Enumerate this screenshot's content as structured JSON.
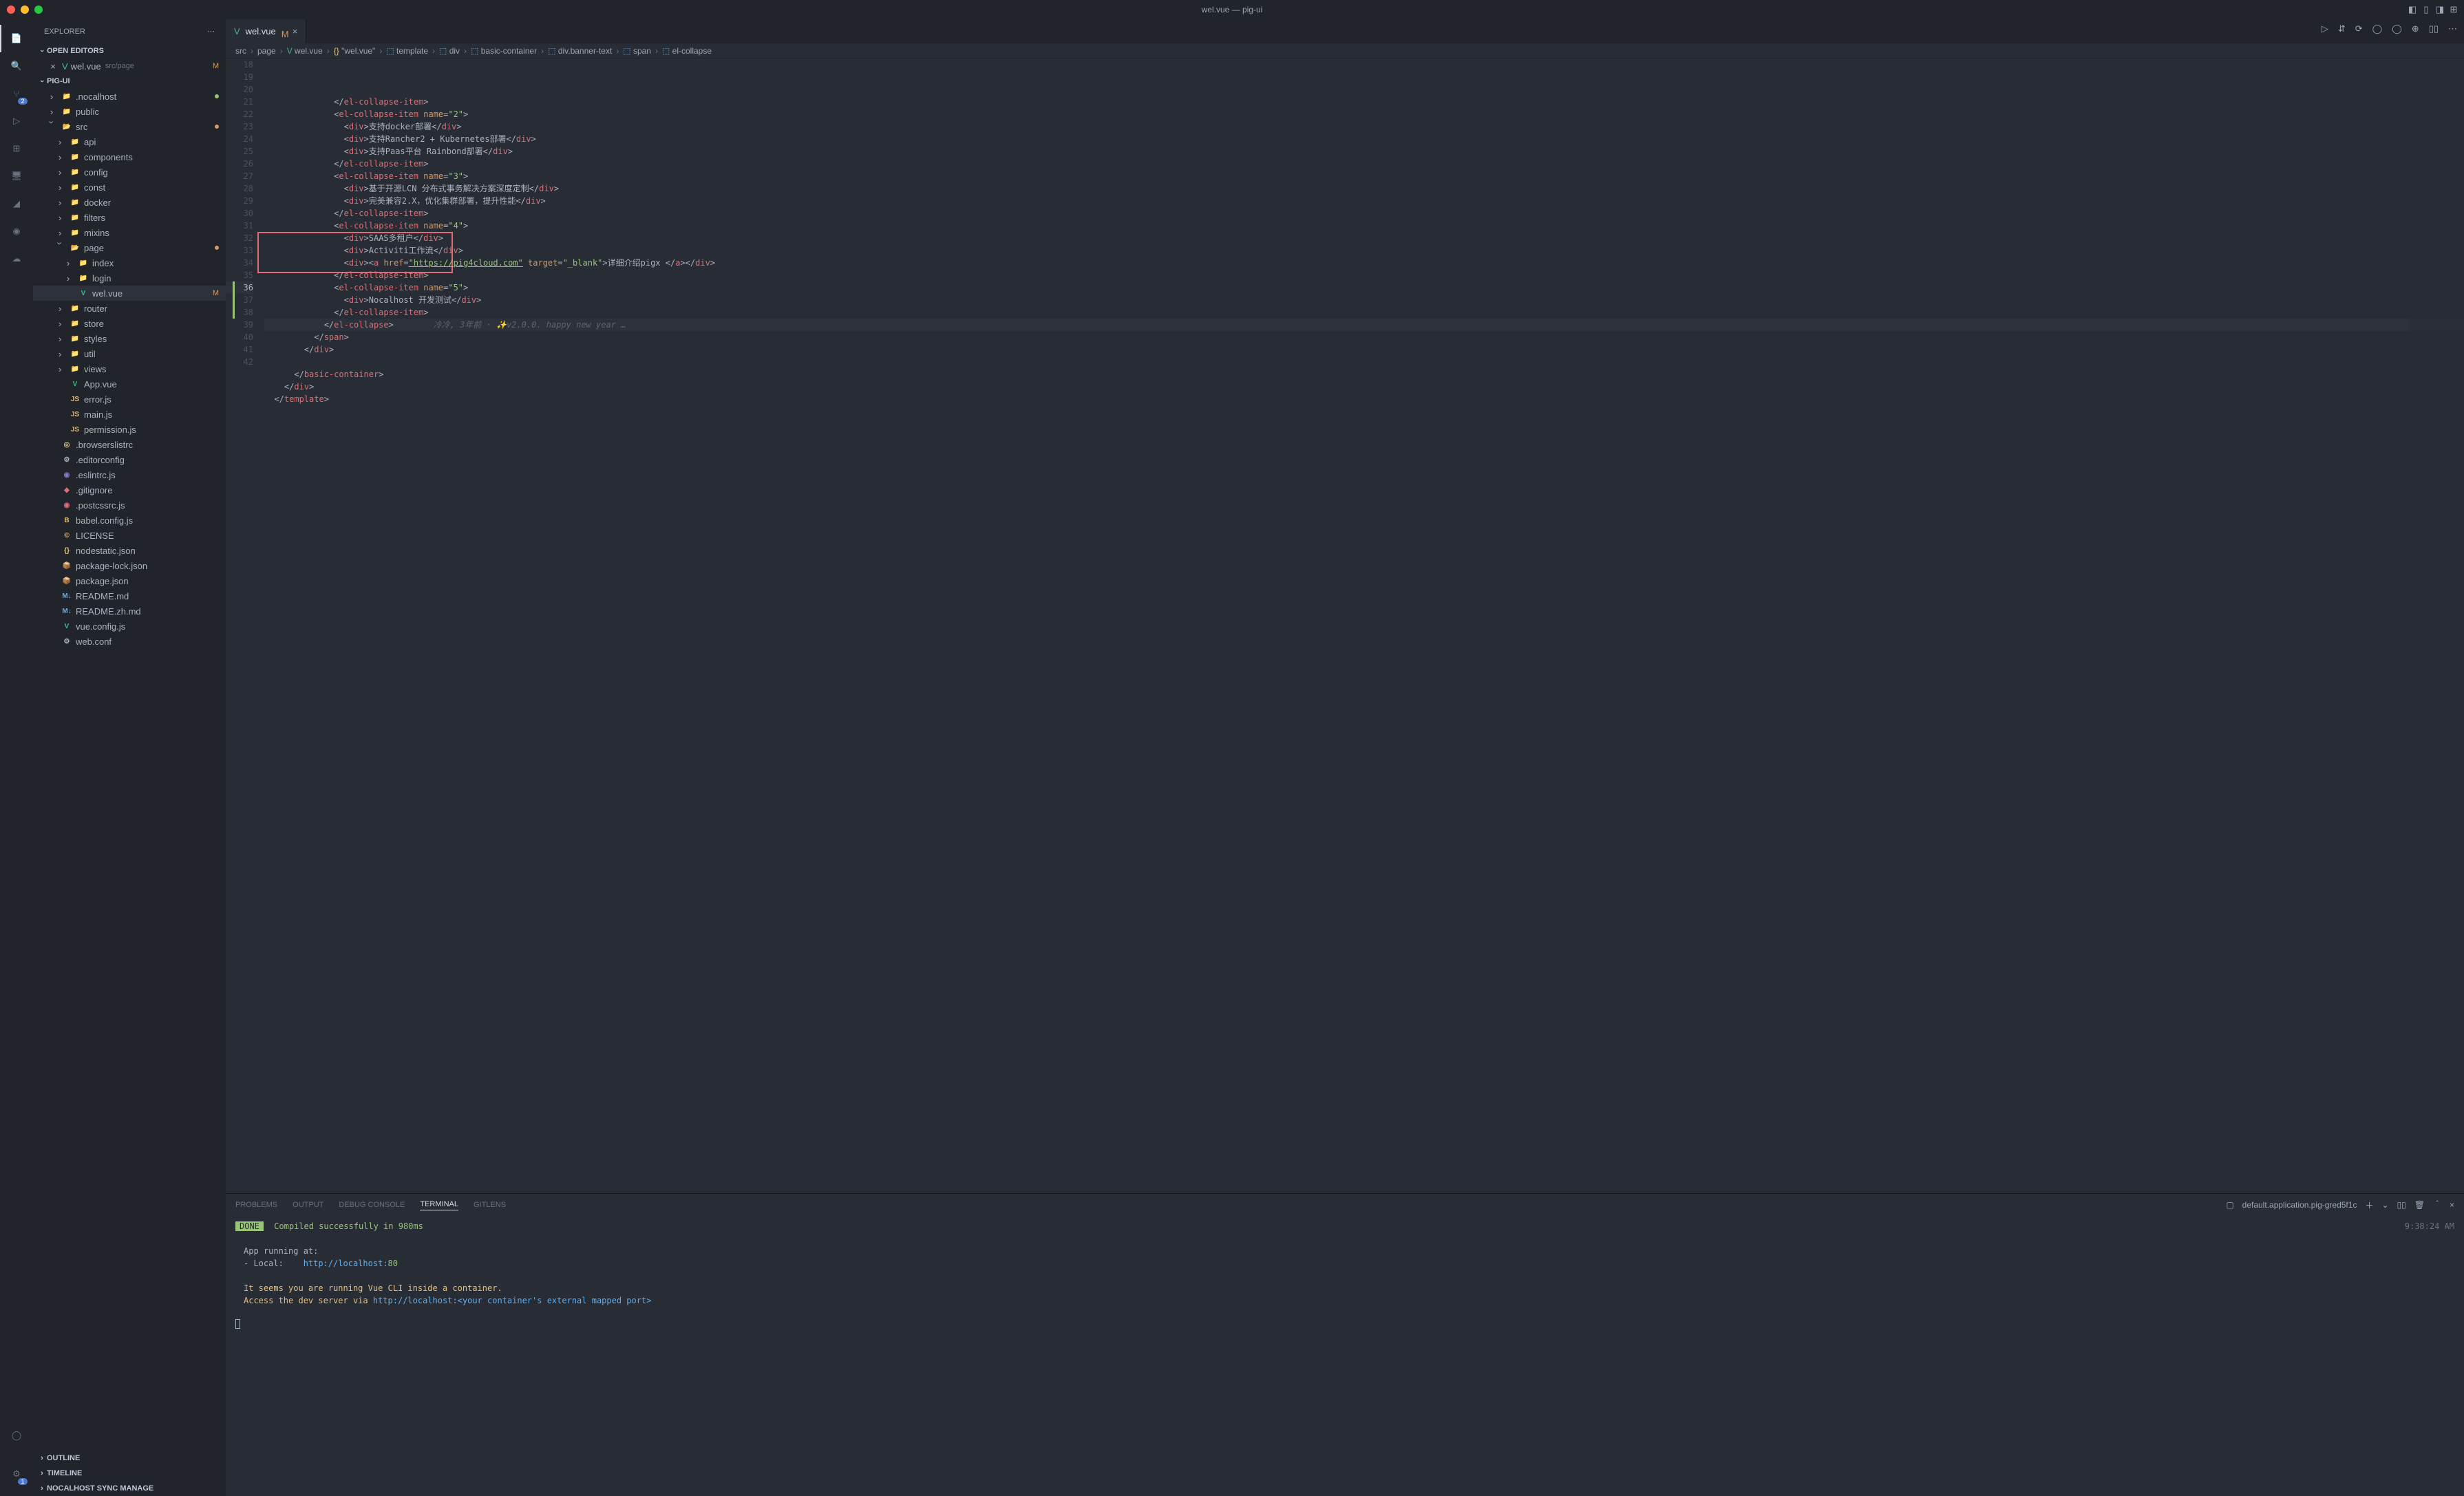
{
  "window": {
    "title": "wel.vue — pig-ui"
  },
  "activitybar": {
    "items": [
      {
        "name": "explorer-icon",
        "active": true
      },
      {
        "name": "search-icon"
      },
      {
        "name": "source-control-icon",
        "badge": "2"
      },
      {
        "name": "run-debug-icon"
      },
      {
        "name": "extensions-icon"
      },
      {
        "name": "remote-explorer-icon"
      },
      {
        "name": "docker-icon"
      },
      {
        "name": "nocalhost-icon"
      },
      {
        "name": "cloud-icon"
      }
    ],
    "bottom": [
      {
        "name": "accounts-icon"
      },
      {
        "name": "settings-gear-icon",
        "badge": "1"
      }
    ]
  },
  "sidebar": {
    "title": "EXPLORER",
    "sections": {
      "openEditors": {
        "label": "OPEN EDITORS",
        "items": [
          {
            "icon": "vue",
            "label": "wel.vue",
            "path": "src/page",
            "status": "M"
          }
        ]
      },
      "project": {
        "label": "PIG-UI",
        "tree": [
          {
            "depth": 1,
            "chev": ">",
            "icon": "folder",
            "label": ".nocalhost",
            "dot": "#98c379"
          },
          {
            "depth": 1,
            "chev": ">",
            "icon": "folder",
            "label": "public"
          },
          {
            "depth": 1,
            "chev": "v",
            "icon": "folder-open",
            "label": "src",
            "dot": "#d19a66"
          },
          {
            "depth": 2,
            "chev": ">",
            "icon": "folder",
            "label": "api"
          },
          {
            "depth": 2,
            "chev": ">",
            "icon": "folder",
            "label": "components"
          },
          {
            "depth": 2,
            "chev": ">",
            "icon": "folder",
            "label": "config"
          },
          {
            "depth": 2,
            "chev": ">",
            "icon": "folder",
            "label": "const"
          },
          {
            "depth": 2,
            "chev": ">",
            "icon": "folder",
            "label": "docker"
          },
          {
            "depth": 2,
            "chev": ">",
            "icon": "folder",
            "label": "filters"
          },
          {
            "depth": 2,
            "chev": ">",
            "icon": "folder",
            "label": "mixins"
          },
          {
            "depth": 2,
            "chev": "v",
            "icon": "folder-open",
            "label": "page",
            "dot": "#d19a66"
          },
          {
            "depth": 3,
            "chev": ">",
            "icon": "folder",
            "label": "index"
          },
          {
            "depth": 3,
            "chev": ">",
            "icon": "folder",
            "label": "login"
          },
          {
            "depth": 3,
            "chev": "",
            "icon": "vue",
            "label": "wel.vue",
            "status": "M",
            "selected": true
          },
          {
            "depth": 2,
            "chev": ">",
            "icon": "folder",
            "label": "router"
          },
          {
            "depth": 2,
            "chev": ">",
            "icon": "folder",
            "label": "store"
          },
          {
            "depth": 2,
            "chev": ">",
            "icon": "folder",
            "label": "styles"
          },
          {
            "depth": 2,
            "chev": ">",
            "icon": "folder",
            "label": "util"
          },
          {
            "depth": 2,
            "chev": ">",
            "icon": "folder",
            "label": "views"
          },
          {
            "depth": 2,
            "chev": "",
            "icon": "vue",
            "label": "App.vue"
          },
          {
            "depth": 2,
            "chev": "",
            "icon": "js",
            "label": "error.js"
          },
          {
            "depth": 2,
            "chev": "",
            "icon": "js",
            "label": "main.js"
          },
          {
            "depth": 2,
            "chev": "",
            "icon": "js",
            "label": "permission.js"
          },
          {
            "depth": 1,
            "chev": "",
            "icon": "browserslist",
            "label": ".browserslistrc"
          },
          {
            "depth": 1,
            "chev": "",
            "icon": "editorconfig",
            "label": ".editorconfig"
          },
          {
            "depth": 1,
            "chev": "",
            "icon": "eslint",
            "label": ".eslintrc.js"
          },
          {
            "depth": 1,
            "chev": "",
            "icon": "git",
            "label": ".gitignore"
          },
          {
            "depth": 1,
            "chev": "",
            "icon": "postcss",
            "label": ".postcssrc.js"
          },
          {
            "depth": 1,
            "chev": "",
            "icon": "babel",
            "label": "babel.config.js"
          },
          {
            "depth": 1,
            "chev": "",
            "icon": "license",
            "label": "LICENSE"
          },
          {
            "depth": 1,
            "chev": "",
            "icon": "json",
            "label": "nodestatic.json"
          },
          {
            "depth": 1,
            "chev": "",
            "icon": "npm",
            "label": "package-lock.json"
          },
          {
            "depth": 1,
            "chev": "",
            "icon": "npm",
            "label": "package.json"
          },
          {
            "depth": 1,
            "chev": "",
            "icon": "md",
            "label": "README.md"
          },
          {
            "depth": 1,
            "chev": "",
            "icon": "md",
            "label": "README.zh.md"
          },
          {
            "depth": 1,
            "chev": "",
            "icon": "vue",
            "label": "vue.config.js"
          },
          {
            "depth": 1,
            "chev": "",
            "icon": "config",
            "label": "web.conf"
          }
        ]
      },
      "outline": {
        "label": "OUTLINE"
      },
      "timeline": {
        "label": "TIMELINE"
      },
      "nocalhost": {
        "label": "NOCALHOST SYNC MANAGE"
      }
    }
  },
  "tab": {
    "icon": "vue",
    "label": "wel.vue",
    "modified": "M"
  },
  "breadcrumbs": [
    {
      "label": "src"
    },
    {
      "label": "page"
    },
    {
      "label": "wel.vue",
      "icon": "vue"
    },
    {
      "label": "\"wel.vue\"",
      "icon": "braces"
    },
    {
      "label": "template",
      "icon": "tag"
    },
    {
      "label": "div",
      "icon": "tag"
    },
    {
      "label": "basic-container",
      "icon": "tag"
    },
    {
      "label": "div.banner-text",
      "icon": "tag"
    },
    {
      "label": "span",
      "icon": "tag"
    },
    {
      "label": "el-collapse",
      "icon": "tag"
    }
  ],
  "editor": {
    "startLine": 18,
    "currentLine": 36,
    "lines": [
      {
        "n": 18,
        "indent": 7,
        "tokens": [
          [
            "t-punc",
            "</"
          ],
          [
            "t-tag",
            "el-collapse-item"
          ],
          [
            "t-punc",
            ">"
          ]
        ]
      },
      {
        "n": 19,
        "indent": 7,
        "tokens": [
          [
            "t-punc",
            "<"
          ],
          [
            "t-tag",
            "el-collapse-item"
          ],
          [
            "t-punc",
            " "
          ],
          [
            "t-attr",
            "name"
          ],
          [
            "t-punc",
            "="
          ],
          [
            "t-str",
            "\"2\""
          ],
          [
            "t-punc",
            ">"
          ]
        ]
      },
      {
        "n": 20,
        "indent": 8,
        "tokens": [
          [
            "t-punc",
            "<"
          ],
          [
            "t-tag",
            "div"
          ],
          [
            "t-punc",
            ">"
          ],
          [
            "t-text",
            "支持docker部署"
          ],
          [
            "t-punc",
            "</"
          ],
          [
            "t-tag",
            "div"
          ],
          [
            "t-punc",
            ">"
          ]
        ]
      },
      {
        "n": 21,
        "indent": 8,
        "tokens": [
          [
            "t-punc",
            "<"
          ],
          [
            "t-tag",
            "div"
          ],
          [
            "t-punc",
            ">"
          ],
          [
            "t-text",
            "支持Rancher2 + Kubernetes部署"
          ],
          [
            "t-punc",
            "</"
          ],
          [
            "t-tag",
            "div"
          ],
          [
            "t-punc",
            ">"
          ]
        ]
      },
      {
        "n": 22,
        "indent": 8,
        "tokens": [
          [
            "t-punc",
            "<"
          ],
          [
            "t-tag",
            "div"
          ],
          [
            "t-punc",
            ">"
          ],
          [
            "t-text",
            "支持Paas平台 Rainbond部署"
          ],
          [
            "t-punc",
            "</"
          ],
          [
            "t-tag",
            "div"
          ],
          [
            "t-punc",
            ">"
          ]
        ]
      },
      {
        "n": 23,
        "indent": 7,
        "tokens": [
          [
            "t-punc",
            "</"
          ],
          [
            "t-tag",
            "el-collapse-item"
          ],
          [
            "t-punc",
            ">"
          ]
        ]
      },
      {
        "n": 24,
        "indent": 7,
        "tokens": [
          [
            "t-punc",
            "<"
          ],
          [
            "t-tag",
            "el-collapse-item"
          ],
          [
            "t-punc",
            " "
          ],
          [
            "t-attr",
            "name"
          ],
          [
            "t-punc",
            "="
          ],
          [
            "t-str",
            "\"3\""
          ],
          [
            "t-punc",
            ">"
          ]
        ]
      },
      {
        "n": 25,
        "indent": 8,
        "tokens": [
          [
            "t-punc",
            "<"
          ],
          [
            "t-tag",
            "div"
          ],
          [
            "t-punc",
            ">"
          ],
          [
            "t-text",
            "基于开源LCN 分布式事务解决方案深度定制"
          ],
          [
            "t-punc",
            "</"
          ],
          [
            "t-tag",
            "div"
          ],
          [
            "t-punc",
            ">"
          ]
        ]
      },
      {
        "n": 26,
        "indent": 8,
        "tokens": [
          [
            "t-punc",
            "<"
          ],
          [
            "t-tag",
            "div"
          ],
          [
            "t-punc",
            ">"
          ],
          [
            "t-text",
            "完美兼容2.X，优化集群部署，提升性能"
          ],
          [
            "t-punc",
            "</"
          ],
          [
            "t-tag",
            "div"
          ],
          [
            "t-punc",
            ">"
          ]
        ]
      },
      {
        "n": 27,
        "indent": 7,
        "tokens": [
          [
            "t-punc",
            "</"
          ],
          [
            "t-tag",
            "el-collapse-item"
          ],
          [
            "t-punc",
            ">"
          ]
        ]
      },
      {
        "n": 28,
        "indent": 7,
        "tokens": [
          [
            "t-punc",
            "<"
          ],
          [
            "t-tag",
            "el-collapse-item"
          ],
          [
            "t-punc",
            " "
          ],
          [
            "t-attr",
            "name"
          ],
          [
            "t-punc",
            "="
          ],
          [
            "t-str",
            "\"4\""
          ],
          [
            "t-punc",
            ">"
          ]
        ]
      },
      {
        "n": 29,
        "indent": 8,
        "tokens": [
          [
            "t-punc",
            "<"
          ],
          [
            "t-tag",
            "div"
          ],
          [
            "t-punc",
            ">"
          ],
          [
            "t-text",
            "SAAS多租户"
          ],
          [
            "t-punc",
            "</"
          ],
          [
            "t-tag",
            "div"
          ],
          [
            "t-punc",
            ">"
          ]
        ],
        "breakpoint": true
      },
      {
        "n": 30,
        "indent": 8,
        "tokens": [
          [
            "t-punc",
            "<"
          ],
          [
            "t-tag",
            "div"
          ],
          [
            "t-punc",
            ">"
          ],
          [
            "t-text",
            "Activiti工作流"
          ],
          [
            "t-punc",
            "</"
          ],
          [
            "t-tag",
            "div"
          ],
          [
            "t-punc",
            ">"
          ]
        ]
      },
      {
        "n": 31,
        "indent": 8,
        "tokens": [
          [
            "t-punc",
            "<"
          ],
          [
            "t-tag",
            "div"
          ],
          [
            "t-punc",
            ">"
          ],
          [
            "t-punc",
            "<"
          ],
          [
            "t-tag",
            "a"
          ],
          [
            "t-punc",
            " "
          ],
          [
            "t-attr",
            "href"
          ],
          [
            "t-punc",
            "="
          ],
          [
            "t-link",
            "\"https://pig4cloud.com\""
          ],
          [
            "t-punc",
            " "
          ],
          [
            "t-attr",
            "target"
          ],
          [
            "t-punc",
            "="
          ],
          [
            "t-str",
            "\"_blank\""
          ],
          [
            "t-punc",
            ">"
          ],
          [
            "t-text",
            "详细介绍pigx "
          ],
          [
            "t-punc",
            "</"
          ],
          [
            "t-tag",
            "a"
          ],
          [
            "t-punc",
            "></"
          ],
          [
            "t-tag",
            "div"
          ],
          [
            "t-punc",
            ">"
          ]
        ]
      },
      {
        "n": 32,
        "indent": 7,
        "tokens": [
          [
            "t-punc",
            "</"
          ],
          [
            "t-tag",
            "el-collapse-item"
          ],
          [
            "t-punc",
            ">"
          ]
        ]
      },
      {
        "n": 33,
        "indent": 7,
        "tokens": [
          [
            "t-punc",
            "<"
          ],
          [
            "t-tag",
            "el-collapse-item"
          ],
          [
            "t-punc",
            " "
          ],
          [
            "t-attr",
            "name"
          ],
          [
            "t-punc",
            "="
          ],
          [
            "t-str",
            "\"5\""
          ],
          [
            "t-punc",
            ">"
          ]
        ],
        "vline": true
      },
      {
        "n": 34,
        "indent": 8,
        "tokens": [
          [
            "t-punc",
            "<"
          ],
          [
            "t-tag",
            "div"
          ],
          [
            "t-punc",
            ">"
          ],
          [
            "t-text",
            "Nocalhost 开发测试"
          ],
          [
            "t-punc",
            "</"
          ],
          [
            "t-tag",
            "div"
          ],
          [
            "t-punc",
            ">"
          ]
        ],
        "vline": true
      },
      {
        "n": 35,
        "indent": 7,
        "tokens": [
          [
            "t-punc",
            "</"
          ],
          [
            "t-tag",
            "el-collapse-item"
          ],
          [
            "t-punc",
            ">"
          ]
        ],
        "vline": true
      },
      {
        "n": 36,
        "indent": 6,
        "tokens": [
          [
            "t-punc",
            "</"
          ],
          [
            "t-tag",
            "el-collapse"
          ],
          [
            "t-punc",
            ">"
          ],
          [
            "t-comment",
            "        冷冷, 3年前 · ✨v2.0.0. happy new year …"
          ]
        ],
        "hl": true
      },
      {
        "n": 37,
        "indent": 5,
        "tokens": [
          [
            "t-punc",
            "</"
          ],
          [
            "t-tag",
            "span"
          ],
          [
            "t-punc",
            ">"
          ]
        ]
      },
      {
        "n": 38,
        "indent": 4,
        "tokens": [
          [
            "t-punc",
            "</"
          ],
          [
            "t-tag",
            "div"
          ],
          [
            "t-punc",
            ">"
          ]
        ]
      },
      {
        "n": 39,
        "indent": 0,
        "tokens": []
      },
      {
        "n": 40,
        "indent": 3,
        "tokens": [
          [
            "t-punc",
            "</"
          ],
          [
            "t-tag",
            "basic-container"
          ],
          [
            "t-punc",
            ">"
          ]
        ]
      },
      {
        "n": 41,
        "indent": 2,
        "tokens": [
          [
            "t-punc",
            "</"
          ],
          [
            "t-tag",
            "div"
          ],
          [
            "t-punc",
            ">"
          ]
        ]
      },
      {
        "n": 42,
        "indent": 1,
        "tokens": [
          [
            "t-punc",
            "</"
          ],
          [
            "t-tag",
            "template"
          ],
          [
            "t-punc",
            ">"
          ]
        ]
      }
    ]
  },
  "panel": {
    "tabs": [
      "PROBLEMS",
      "OUTPUT",
      "DEBUG CONSOLE",
      "TERMINAL",
      "GITLENS"
    ],
    "activeTab": "TERMINAL",
    "terminalSelector": "default.application.pig-gred5f1c",
    "terminal": {
      "doneLabel": "DONE",
      "compiled": "Compiled successfully in 980ms",
      "timestamp": "9:38:24 AM",
      "runningAt": "App running at:",
      "localLabel": "- Local:",
      "localUrl": "http://localhost:",
      "localPort": "80",
      "warn1": "It seems you are running Vue CLI inside a container.",
      "warn2a": "Access the dev server via ",
      "warn2b": "http://localhost:<your container's external mapped port>"
    }
  }
}
